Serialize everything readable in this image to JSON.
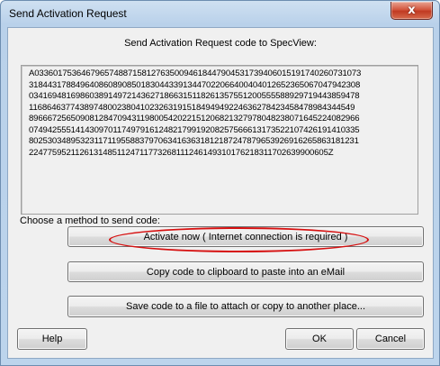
{
  "window": {
    "title": "Send Activation Request",
    "close_glyph": "x"
  },
  "dialog": {
    "header": "Send Activation Request code to SpecView:",
    "code_lines": [
      "A03360175364679657488715812763500946184479045317394060151917402607310​73",
      "318443178849640860890850183044339134470220664004040126523650670479423​08",
      "034169481698603891497214362718663151182613575512005555889297194438594​78",
      "116864637743897480023804102326319151849494922463627842345847898434454​9",
      "896667256509081284709431198005420221512068213279780482380716452240829​66",
      "074942555141430970117497916124821799192082575666131735221074261914103​35",
      "802530348953231171195588379706341636318121872478796539269162658631812​31",
      "2247759521126131485112471177326811124614931017621831170263990060​5Z"
    ],
    "method_label": "Choose a method to send code:",
    "buttons": {
      "activate_now": "Activate now ( Internet connection is required )",
      "copy_clipboard": "Copy code to clipboard to paste into an eMail",
      "save_file": "Save code to a file to attach or copy to another place...",
      "help": "Help",
      "ok": "OK",
      "cancel": "Cancel"
    }
  },
  "colors": {
    "highlight_ellipse": "#d61010",
    "close_button": "#c9482f"
  }
}
